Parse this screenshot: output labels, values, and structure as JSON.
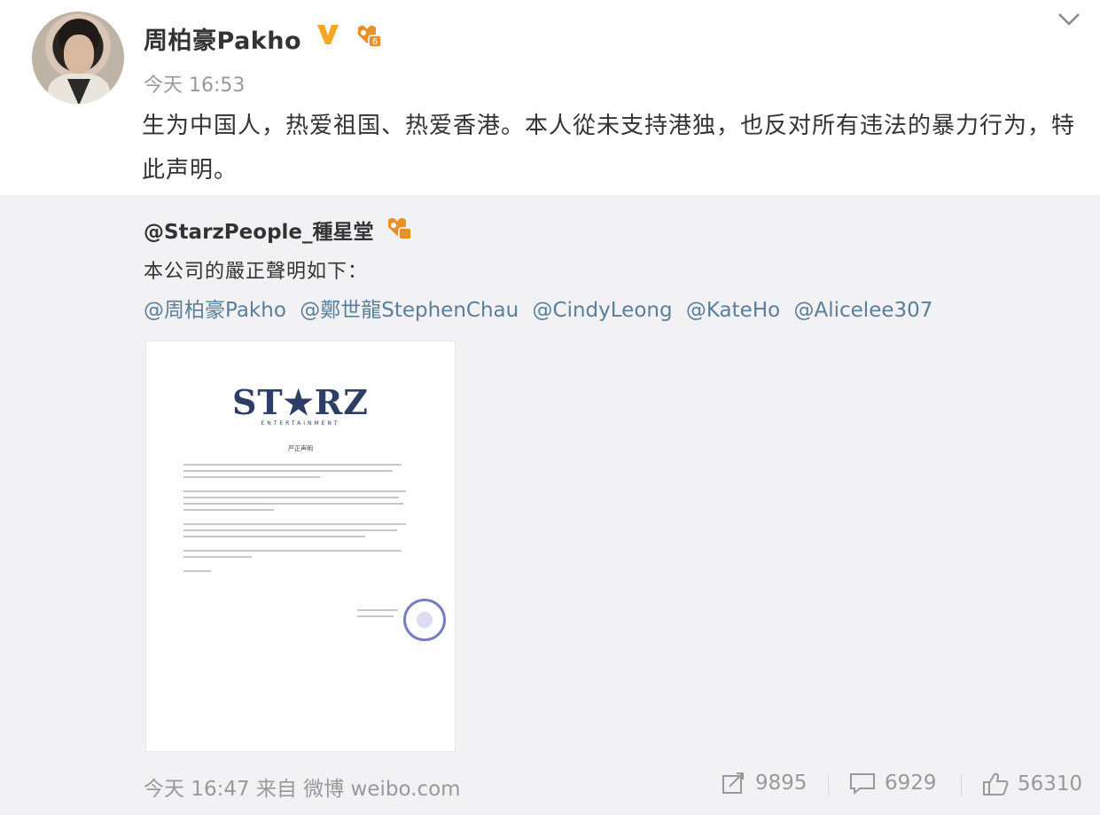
{
  "post": {
    "username": "周柏豪Pakho",
    "time": "今天 16:53",
    "text": "生为中国人，热爱祖国、热爱香港。本人從未支持港独，也反对所有违法的暴力行为，特此声明。"
  },
  "repost": {
    "author": "@StarzPeople_種星堂",
    "text": "本公司的嚴正聲明如下：",
    "mentions": [
      "@周柏豪Pakho",
      "@鄭世龍StephenChau",
      "@CindyLeong",
      "@KateHo",
      "@Alicelee307"
    ],
    "image": {
      "logo": "ST★RZ",
      "logo_sub": "ENTERTAINMENT",
      "heading": "严正声明"
    },
    "footer_time": "今天 16:47 来自 微博 weibo.com",
    "reposts": "9895",
    "comments": "6929",
    "likes": "56310"
  },
  "colors": {
    "link": "#5a7f99",
    "verified": "#f5a623",
    "badge": "#e8902a",
    "repost_bg": "#f2f2f5"
  },
  "icons": {
    "verified": "verified-v-icon",
    "member": "member-badge-icon",
    "menu": "chevron-down-icon",
    "repost": "repost-icon",
    "comment": "comment-icon",
    "like": "thumbs-up-icon"
  }
}
